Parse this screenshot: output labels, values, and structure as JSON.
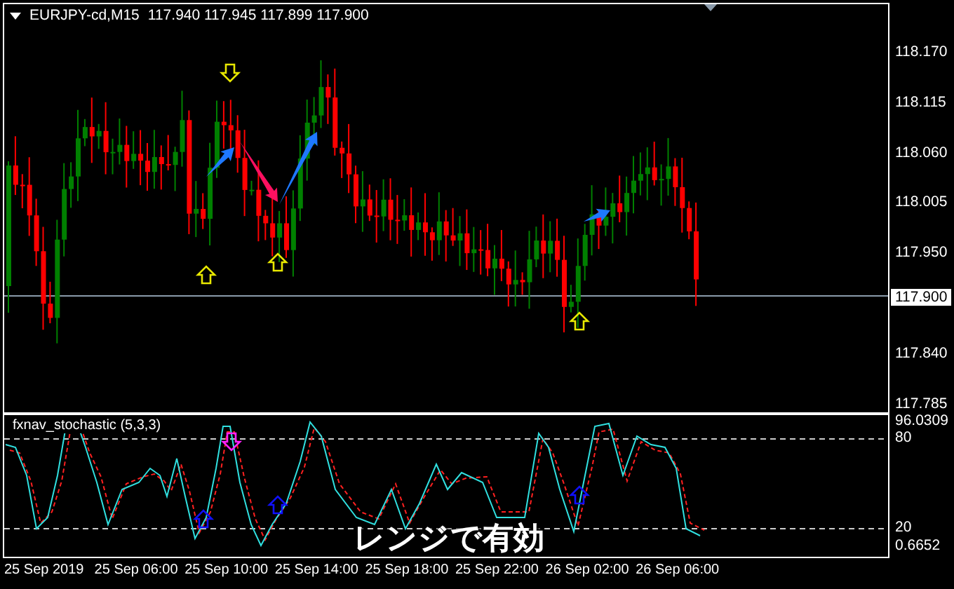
{
  "chart": {
    "symbol": "EURJPY-cd,M15",
    "prices": "117.940 117.945 117.899 117.900",
    "price_axis": [
      "118.170",
      "118.115",
      "118.060",
      "118.005",
      "117.950",
      "117.840",
      "117.785"
    ],
    "current_price": "117.900"
  },
  "indicator": {
    "name": "fxnav_stochastic (5,3,3)",
    "axis": [
      "96.0309",
      "80",
      "20",
      "0.6652"
    ]
  },
  "time_axis": [
    "25 Sep 2019",
    "25 Sep 06:00",
    "25 Sep 10:00",
    "25 Sep 14:00",
    "25 Sep 18:00",
    "25 Sep 22:00",
    "26 Sep 02:00",
    "26 Sep 06:00"
  ],
  "caption": "レンジで有効"
}
